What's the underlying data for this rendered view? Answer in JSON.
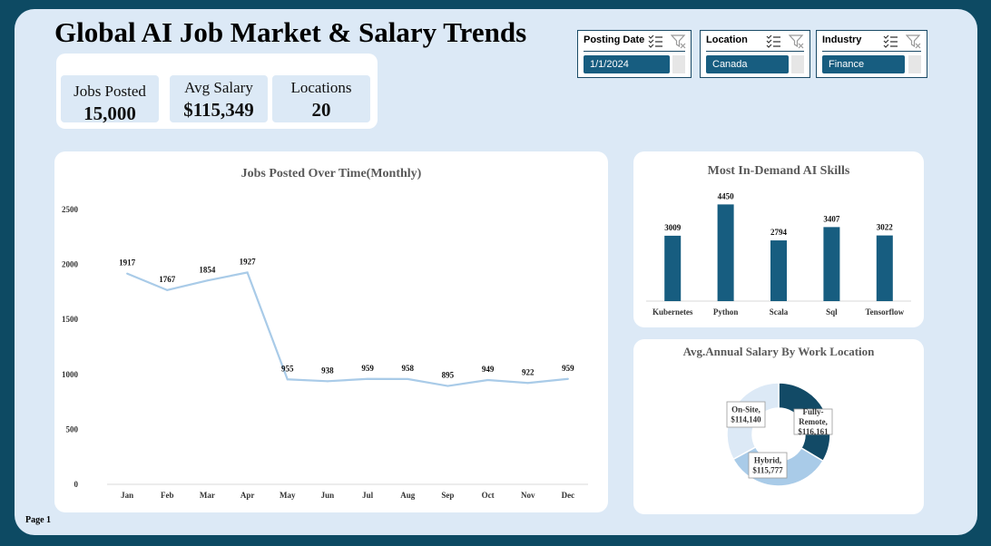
{
  "title": "Global AI Job Market & Salary Trends",
  "kpis": [
    {
      "label": "Jobs Posted",
      "value": "15,000"
    },
    {
      "label": "Avg Salary",
      "value": "$115,349"
    },
    {
      "label": "Locations",
      "value": "20"
    }
  ],
  "slicers": [
    {
      "header": "Posting Date",
      "selected": "1/1/2024"
    },
    {
      "header": "Location",
      "selected": "Canada"
    },
    {
      "header": "Industry",
      "selected": "Finance"
    }
  ],
  "page_label": "Page 1",
  "colors": {
    "dark_blue": "#175d80",
    "light_line": "#a9cbe8",
    "background": "#0d4a63",
    "panel": "#dce9f6"
  },
  "chart_data": [
    {
      "type": "line",
      "title": "Jobs Posted Over Time(Monthly)",
      "categories": [
        "Jan",
        "Feb",
        "Mar",
        "Apr",
        "May",
        "Jun",
        "Jul",
        "Aug",
        "Sep",
        "Oct",
        "Nov",
        "Dec"
      ],
      "values": [
        1917,
        1767,
        1854,
        1927,
        955,
        938,
        959,
        958,
        895,
        949,
        922,
        959
      ],
      "yticks": [
        0,
        500,
        1000,
        1500,
        2000,
        2500
      ],
      "ylim": [
        0,
        2500
      ],
      "grid": false
    },
    {
      "type": "bar",
      "title": "Most In-Demand AI Skills",
      "categories": [
        "Kubernetes",
        "Python",
        "Scala",
        "Sql",
        "Tensorflow"
      ],
      "values": [
        3009,
        4450,
        2794,
        3407,
        3022
      ],
      "ylim": [
        0,
        4800
      ]
    },
    {
      "type": "pie",
      "title": "Avg.Annual Salary By Work Location",
      "slices": [
        {
          "label": "Fully-Remote",
          "value": 116161,
          "display": "$116,161",
          "color": "#124a66"
        },
        {
          "label": "Hybrid",
          "value": 115777,
          "display": "$115,777",
          "color": "#a9cbe8"
        },
        {
          "label": "On-Site",
          "value": 114140,
          "display": "$114,140",
          "color": "#dce9f6"
        }
      ]
    }
  ]
}
